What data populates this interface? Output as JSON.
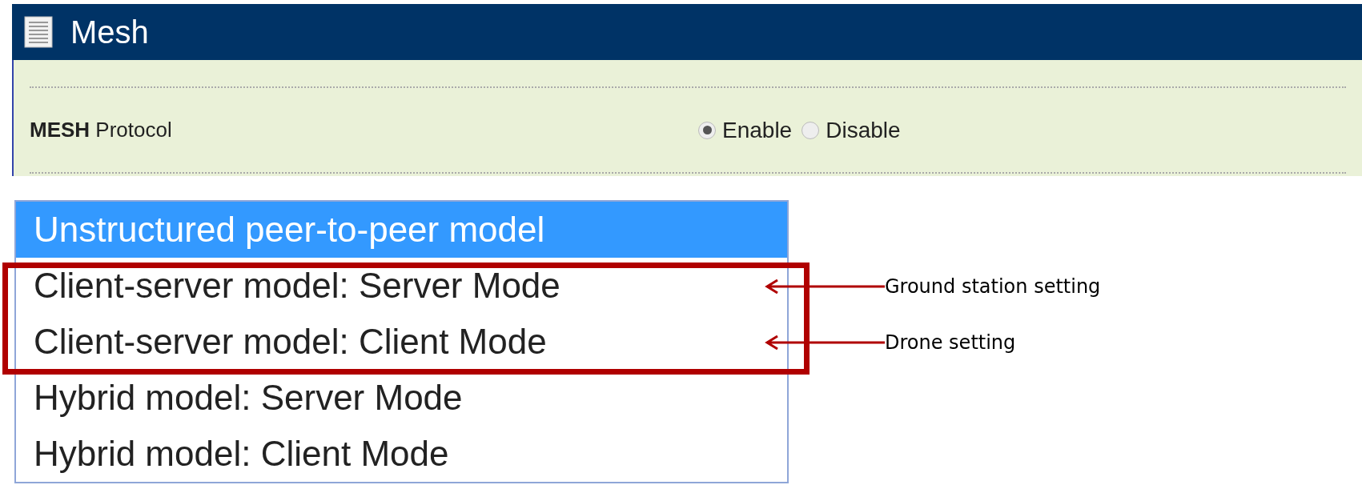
{
  "panel": {
    "title": "Mesh",
    "setting": {
      "label": "**MESH** Protocol",
      "options": [
        {
          "label": "Enable",
          "selected": true
        },
        {
          "label": "Disable",
          "selected": false
        }
      ]
    }
  },
  "dropdown": {
    "options": [
      {
        "label": "Unstructured peer-to-peer model",
        "selected": true
      },
      {
        "label": "Client-server model: Server Mode",
        "selected": false
      },
      {
        "label": "Client-server model: Client Mode",
        "selected": false
      },
      {
        "label": "Hybrid model: Server Mode",
        "selected": false
      },
      {
        "label": "Hybrid model: Client Mode",
        "selected": false
      }
    ]
  },
  "annotations": [
    "Ground station setting",
    "Drone setting"
  ]
}
